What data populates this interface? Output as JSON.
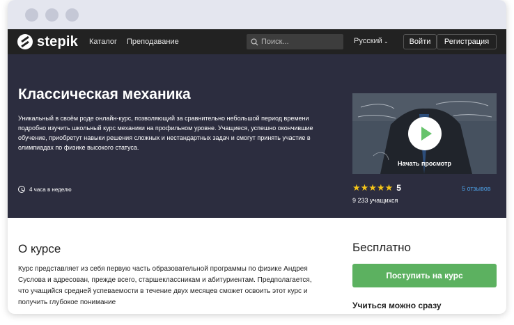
{
  "browser": {
    "dots": [
      "#c5c8d6",
      "#c5c8d6",
      "#c5c8d6"
    ]
  },
  "header": {
    "logo_text": "stepik",
    "nav_catalog": "Каталог",
    "nav_teaching": "Преподавание",
    "search_placeholder": "Поиск...",
    "language": "Русский",
    "login": "Войти",
    "register": "Регистрация"
  },
  "course": {
    "title": "Классическая механика",
    "description": "Уникальный в своём роде онлайн-курс, позволяющий за сравнительно небольшой период времени подробно изучить школьный курс механики на профильном уровне. Учащиеся, успешно окончившие обучение, приобретут навыки решения сложных и нестандартных задач и смогут принять участие в олимпиадах по физике высокого статуса.",
    "workload": "4 часа в неделю",
    "video_label": "Начать просмотр",
    "stars": "★★★★★",
    "rating": "5",
    "reviews": "5 отзывов",
    "learners": "9 233 учащихся"
  },
  "about": {
    "heading": "О курсе",
    "text": "Курс представляет из себя первую часть образовательной программы по физике Андрея Суслова и адресован, прежде всего, старшеклассникам и абитуриентам. Предполагается, что учащийся средней успеваемости в течение двух месяцев сможет освоить этот курс и получить глубокое понимание"
  },
  "enroll": {
    "price": "Бесплатно",
    "button": "Поступить на курс",
    "start_now": "Учиться можно сразу"
  },
  "colors": {
    "nav_bg": "#222222",
    "hero_bg": "#2c2d3f",
    "accent_green": "#5cb160",
    "star": "#f5c518",
    "link": "#4c9de0"
  }
}
